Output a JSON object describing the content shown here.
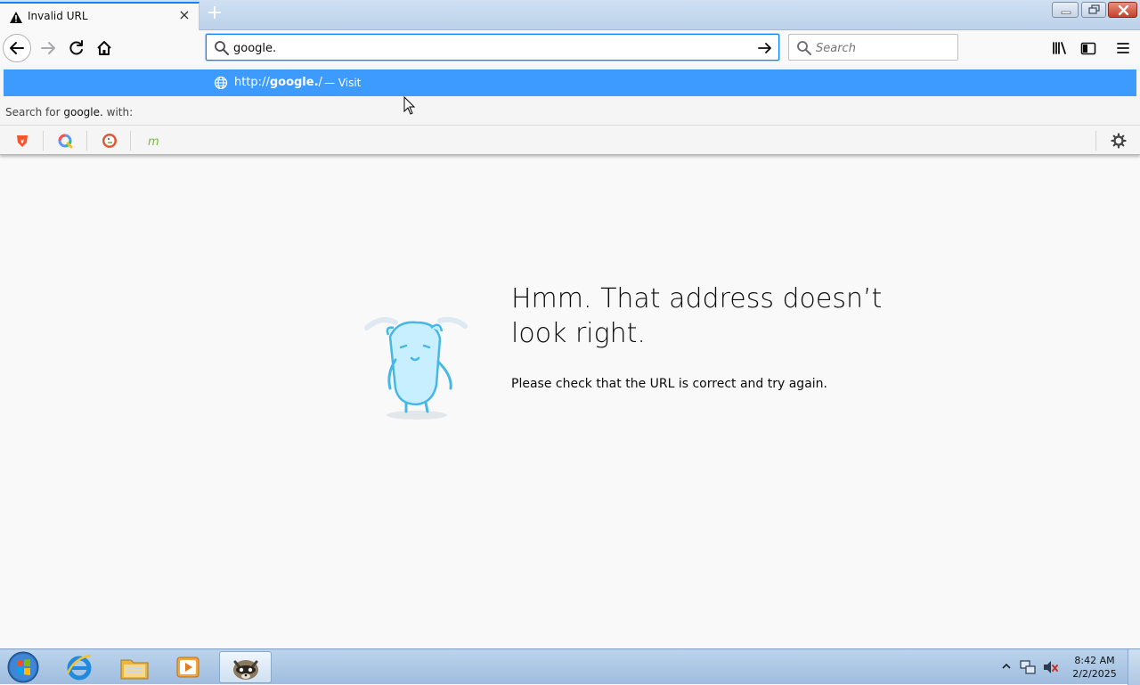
{
  "tab": {
    "title": "Invalid URL",
    "icon": "warning-icon"
  },
  "navbar": {
    "url_value": "google.",
    "search_placeholder": "Search"
  },
  "dropdown": {
    "suggestion_url_prefix": "http://",
    "suggestion_url_host": "google.",
    "suggestion_url_suffix": "/",
    "suggestion_action": "— Visit",
    "search_for_prefix": "Search for",
    "search_for_query": "google.",
    "search_for_suffix": "with:",
    "engines": [
      "brave-icon",
      "qwant-icon",
      "duckduckgo-icon",
      "mojeek-icon"
    ]
  },
  "error": {
    "title": "Hmm. That address doesn’t look right.",
    "description": "Please check that the URL is correct and try again."
  },
  "taskbar": {
    "time": "8:42 AM",
    "date": "2/2/2025"
  },
  "colors": {
    "accent": "#0a84ff",
    "suggestion_highlight": "#3d9bff"
  }
}
